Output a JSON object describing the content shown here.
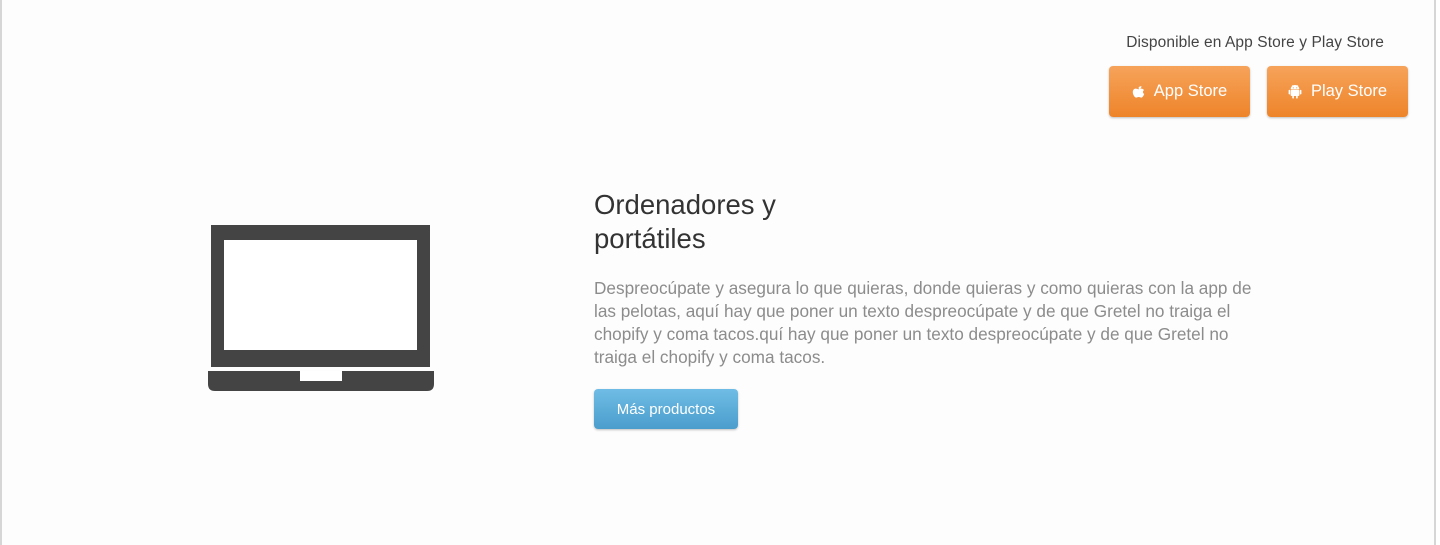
{
  "store": {
    "caption": "Disponible en App Store y Play Store",
    "app_store": {
      "label": "App Store",
      "icon": "apple-icon"
    },
    "play_store": {
      "label": "Play Store",
      "icon": "android-icon"
    },
    "button_color": "#f28f3b"
  },
  "product": {
    "icon": "laptop-icon",
    "title_line1": "Ordenadores y",
    "title_line2": "portátiles",
    "description": "Despreocúpate y asegura lo que quieras, donde quieras y como quieras con la app de las pelotas, aquí hay que poner un texto despreocúpate y de que Gretel no traiga el chopify y coma tacos.quí hay que poner un texto despreocúpate y de que Gretel no traiga el chopify y coma tacos.",
    "more_button": "Más productos",
    "more_button_color": "#5aaad8"
  }
}
